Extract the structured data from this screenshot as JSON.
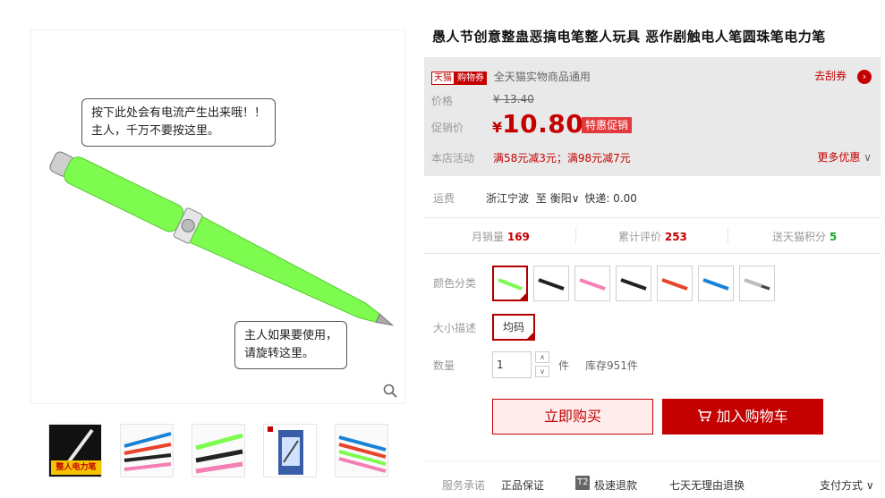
{
  "product": {
    "title": "愚人节创意整蛊恶搞电笔整人玩具 恶作剧触电人笔圆珠笔电力笔"
  },
  "gallery": {
    "bubble_top": [
      "按下此处会有电流产生出来哦！！",
      "主人，千万不要按这里。"
    ],
    "bubble_bottom": [
      "主人如果要使用，",
      "请旋转这里。"
    ],
    "thumb1_caption": "整人电力笔"
  },
  "coupon": {
    "tmall": "天猫",
    "label": "购物券",
    "desc": "全天猫实物商品通用",
    "link": "去刮券"
  },
  "price": {
    "label": "价格",
    "currency": "¥",
    "original": "13.40",
    "promo_label": "促销价",
    "promo_currency": "¥",
    "promo": "10.80",
    "promo_tag": "特惠促销"
  },
  "activity": {
    "label": "本店活动",
    "text": "满58元减3元；满98元减7元",
    "more": "更多优惠"
  },
  "shipping": {
    "label": "运费",
    "from": "浙江宁波",
    "to_word": "至",
    "to": "衡阳",
    "express": "快递: 0.00"
  },
  "stats": {
    "monthly_label": "月销量",
    "monthly": "169",
    "reviews_label": "累计评价",
    "reviews": "253",
    "points_label": "送天猫积分",
    "points": "5"
  },
  "sku": {
    "color_label": "颜色分类",
    "colors": [
      "#7dfb4f",
      "#222222",
      "#f47fb5",
      "#222222",
      "#e8432b",
      "#1a82d6",
      "#d0d0d0"
    ],
    "size_label": "大小描述",
    "size_option": "均码",
    "qty_label": "数量",
    "qty_value": "1",
    "qty_unit": "件",
    "stock": "库存951件"
  },
  "buttons": {
    "buy": "立即购买",
    "cart": "加入购物车"
  },
  "services": {
    "label": "服务承诺",
    "items": [
      "正品保证",
      "极速退款",
      "七天无理由退换"
    ],
    "t2_badge": "T2",
    "payment": "支付方式"
  },
  "colors": {
    "accent": "#c40000",
    "pen_green": "#7dfb4f"
  }
}
